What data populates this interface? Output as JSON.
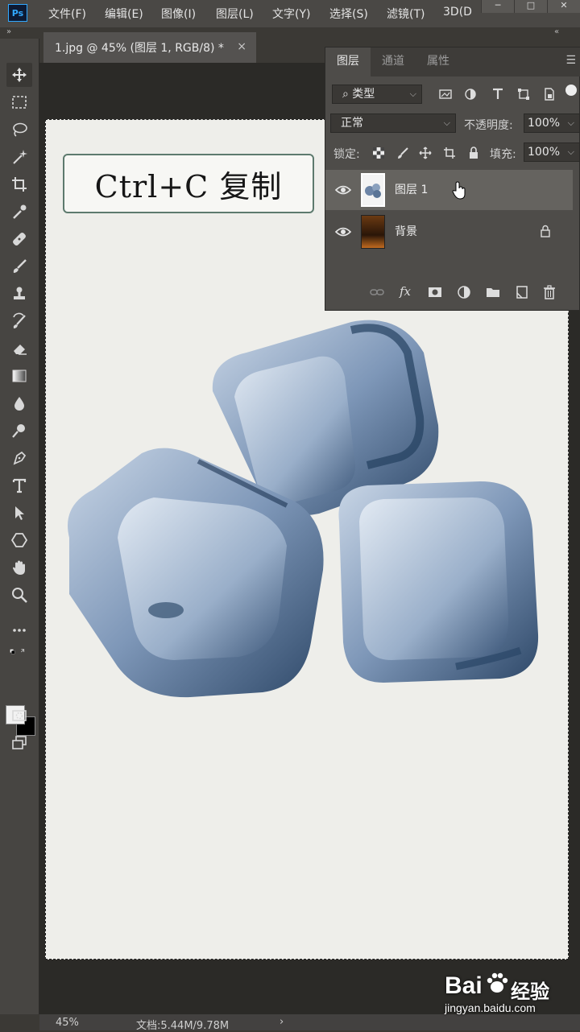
{
  "app": {
    "logo": "Ps"
  },
  "menubar": {
    "items": [
      "文件(F)",
      "编辑(E)",
      "图像(I)",
      "图层(L)",
      "文字(Y)",
      "选择(S)",
      "滤镜(T)",
      "3D(D"
    ]
  },
  "document": {
    "tab_title": "1.jpg @ 45% (图层 1, RGB/8) *",
    "close_glyph": "×"
  },
  "canvas": {
    "hint_text": "Ctrl+C  复制"
  },
  "layers_panel": {
    "tabs": [
      "图层",
      "通道",
      "属性"
    ],
    "filter_kind": "类型",
    "blend_mode": "正常",
    "opacity_label": "不透明度:",
    "opacity_value": "100%",
    "lock_label": "锁定:",
    "fill_label": "填充:",
    "fill_value": "100%",
    "layers": [
      {
        "name": "图层 1",
        "selected": true,
        "locked": false
      },
      {
        "name": "背景",
        "selected": false,
        "locked": true
      }
    ],
    "fx_label": "fx"
  },
  "statusbar": {
    "zoom": "45%",
    "doc_info": "文档:5.44M/9.78M",
    "arrow": "›"
  },
  "watermark": {
    "brand": "Bai",
    "brand_cn": "经验",
    "url": "jingyan.baidu.com"
  },
  "colors": {
    "accent": "#31a8ff",
    "foreground_swatch": "#f2f2f2",
    "background_swatch": "#000000"
  }
}
